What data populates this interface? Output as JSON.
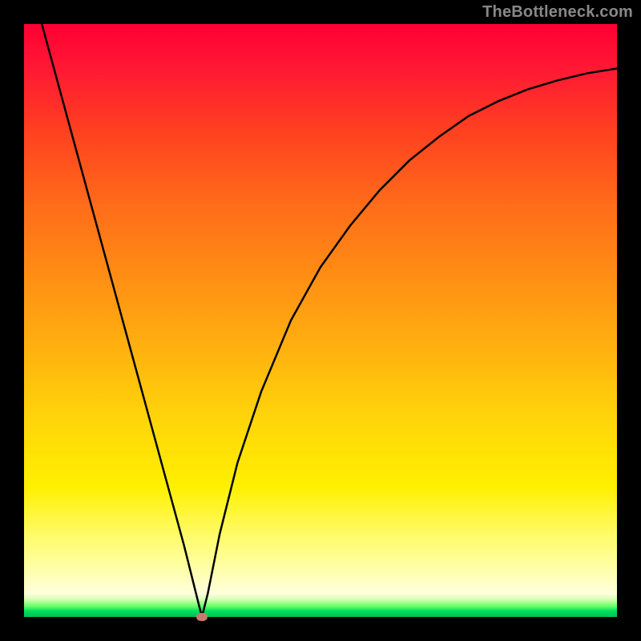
{
  "watermark": "TheBottleneck.com",
  "chart_data": {
    "type": "line",
    "title": "",
    "xlabel": "",
    "ylabel": "",
    "xlim": [
      0,
      100
    ],
    "ylim": [
      0,
      100
    ],
    "grid": false,
    "series": [
      {
        "name": "curve",
        "x": [
          3,
          6,
          9,
          12,
          15,
          18,
          21,
          24,
          27,
          29,
          30,
          31,
          33,
          36,
          40,
          45,
          50,
          55,
          60,
          65,
          70,
          75,
          80,
          85,
          90,
          95,
          100
        ],
        "values": [
          100,
          89,
          78,
          67,
          56,
          45,
          34,
          23,
          12,
          4,
          0,
          4,
          14,
          26,
          38,
          50,
          59,
          66,
          72,
          77,
          81,
          84.5,
          87,
          89,
          90.5,
          91.7,
          92.5
        ]
      }
    ],
    "min_point": {
      "x": 30,
      "y": 0
    },
    "gradient_stops": [
      {
        "pos": 0,
        "color": "#ff0033"
      },
      {
        "pos": 50,
        "color": "#ffb20f"
      },
      {
        "pos": 80,
        "color": "#fff000"
      },
      {
        "pos": 100,
        "color": "#00c050"
      }
    ]
  }
}
